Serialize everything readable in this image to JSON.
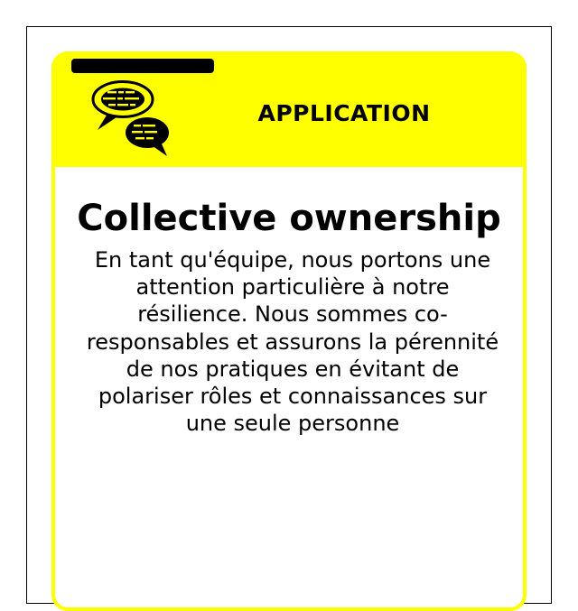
{
  "card": {
    "category": "APPLICATION",
    "title": "Collective ownership",
    "description": "En tant qu'équipe, nous portons une attention particulière à notre résilience. Nous sommes co-responsables et assurons la pérennité de nos pratiques en évitant de polariser rôles et connaissances sur une seule personne",
    "icon": "chat-bubbles-icon",
    "colors": {
      "accent": "#ffff00",
      "text": "#000000",
      "background": "#ffffff"
    }
  }
}
